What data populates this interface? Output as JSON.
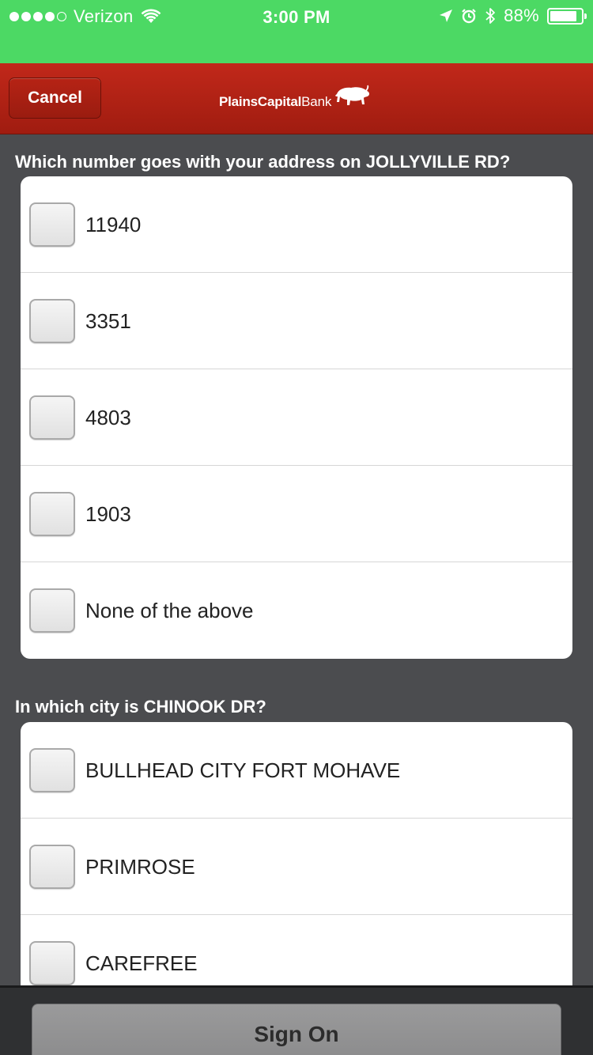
{
  "status_bar": {
    "carrier": "Verizon",
    "time": "3:00 PM",
    "battery_text": "88%",
    "battery_level": 0.88,
    "signal_bars": 4,
    "icons": [
      "wifi-icon",
      "location-arrow-icon",
      "alarm-icon",
      "bluetooth-icon",
      "battery-icon"
    ]
  },
  "header": {
    "cancel_label": "Cancel",
    "brand_bold": "PlainsCapital",
    "brand_regular": "Bank",
    "logo_icon": "buffalo-icon",
    "background_color": "#b42417"
  },
  "questions": [
    {
      "label": "Which number goes with your address on JOLLYVILLE RD?",
      "options": [
        "11940",
        "3351",
        "4803",
        "1903",
        "None of the above"
      ]
    },
    {
      "label": "In which city is CHINOOK DR?",
      "options": [
        "BULLHEAD CITY FORT MOHAVE",
        "PRIMROSE",
        "CAREFREE"
      ]
    }
  ],
  "footer": {
    "sign_on_label": "Sign On"
  },
  "colors": {
    "status_bar": "#4cd964",
    "page_background": "#4b4c4f",
    "card": "#ffffff"
  }
}
